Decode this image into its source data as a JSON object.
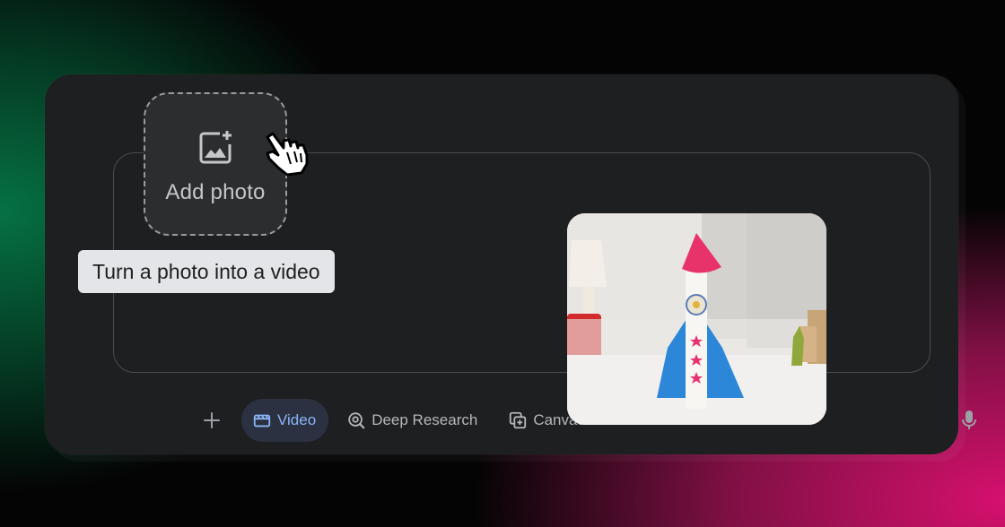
{
  "composer": {
    "add_photo_label": "Add photo",
    "tooltip": "Turn a photo into a video",
    "tools": [
      {
        "label": "Video",
        "icon": "video-icon",
        "active": true
      },
      {
        "label": "Deep Research",
        "icon": "deep-research-icon",
        "active": false
      },
      {
        "label": "Canvas",
        "icon": "canvas-icon",
        "active": false
      }
    ]
  },
  "colors": {
    "panel": "#1e1f20",
    "active_chip_text": "#8ab4f8",
    "tooltip_bg": "#e4e5e8"
  }
}
